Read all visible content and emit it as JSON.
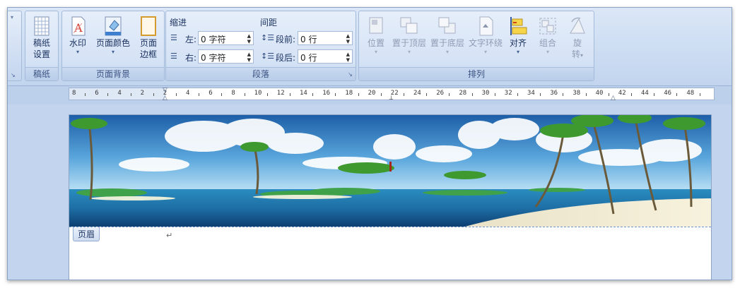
{
  "ribbon": {
    "groups": {
      "paper": {
        "title": "稿纸",
        "buttons": {
          "paper_setup": "稿纸\n设置"
        }
      },
      "page_bg": {
        "title": "页面背景",
        "buttons": {
          "watermark": "水印",
          "page_color": "页面颜色",
          "page_border_line1": "页面",
          "page_border_line2": "边框"
        }
      },
      "paragraph": {
        "title": "段落",
        "indent": {
          "label": "缩进",
          "left_label": "左:",
          "left_value": "0 字符",
          "right_label": "右:",
          "right_value": "0 字符"
        },
        "spacing": {
          "label": "间距",
          "before_label": "段前:",
          "before_value": "0 行",
          "after_label": "段后:",
          "after_value": "0 行"
        }
      },
      "arrange": {
        "title": "排列",
        "buttons": {
          "position": "位置",
          "bring_front": "置于顶层",
          "send_back": "置于底层",
          "text_wrap": "文字环绕",
          "align": "对齐",
          "group": "组合",
          "rotate_line1": "旋",
          "rotate_line2": "转"
        }
      }
    },
    "caret": "▾",
    "launcher": "↘"
  },
  "ruler": {
    "ticks": [
      "8",
      "6",
      "4",
      "2",
      "2",
      "4",
      "6",
      "8",
      "10",
      "12",
      "14",
      "16",
      "18",
      "20",
      "22",
      "24",
      "26",
      "28",
      "30",
      "32",
      "34",
      "36",
      "38",
      "40",
      "42",
      "44",
      "46",
      "48"
    ]
  },
  "document": {
    "header_tab": "页眉",
    "paragraph_mark": "↵"
  },
  "colors": {
    "accent": "#3b5281",
    "ribbon_bg": "#d4e2f5",
    "workspace": "#c3d5ee"
  }
}
